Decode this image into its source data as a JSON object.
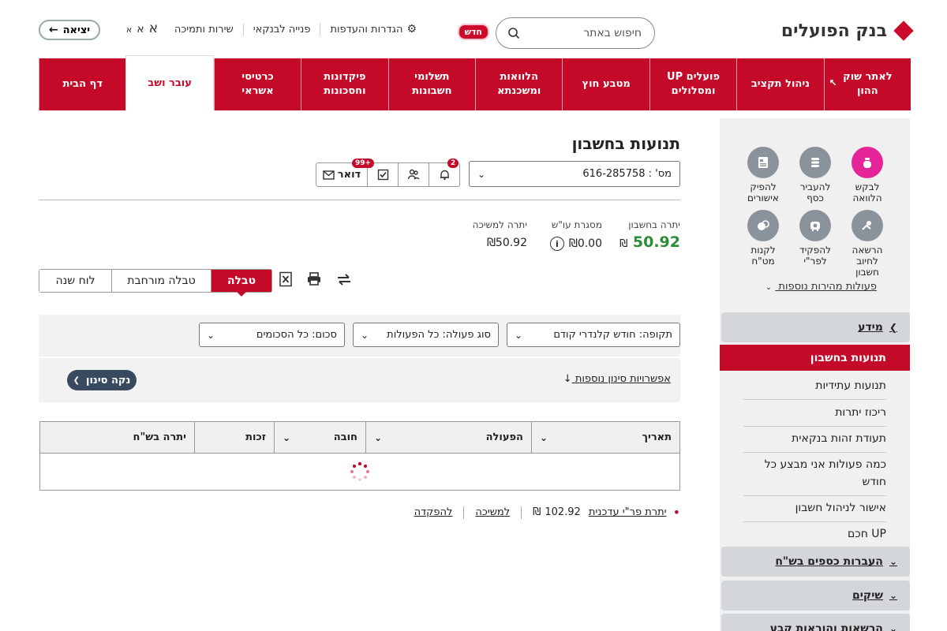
{
  "header": {
    "logo_text": "בנק הפועלים",
    "search_placeholder": "חיפוש באתר",
    "new_badge": "חדש",
    "links": [
      "הגדרות והעדפות",
      "פנייה לבנקאי",
      "שירות ותמיכה"
    ],
    "font_sizes": [
      "א",
      "א",
      "א"
    ],
    "logout_label": "יציאה"
  },
  "nav": {
    "items": [
      "דף הבית",
      "עובר ושב",
      "כרטיסי אשראי",
      "פיקדונות וחסכונות",
      "תשלומי חשבונות",
      "הלוואות ומשכנתא",
      "מטבע חוץ",
      "פועלים UP ומסלולים",
      "ניהול תקציב",
      "לאתר שוק ההון"
    ],
    "active": "עובר ושב"
  },
  "sidebar": {
    "quick_actions": [
      "לבקש הלוואה",
      "להעביר כסף",
      "להפיק אישורים",
      "הרשאה לחיוב חשבון",
      "להפקיד לפר\"י",
      "לקנות מט\"ח"
    ],
    "more_label": "פעולות מהירות נוספות",
    "sections": [
      "מידע",
      "העברות כספים בש\"ח",
      "שיקים",
      "הרשאות והוראות קבע"
    ],
    "active_item": "תנועות בחשבון",
    "sub_items": [
      "תנועות עתידיות",
      "ריכוז יתרות",
      "תעודת זהות בנקאית",
      "כמה פעולות אני מבצע כל חודש",
      "אישור לניהול חשבון",
      "UP חכם"
    ]
  },
  "main": {
    "title": "תנועות בחשבון",
    "account_label": "מס'  :  616-285758",
    "mail_label": "דואר",
    "mail_badge": "+99",
    "bell_badge": "2",
    "balances": {
      "account_label": "יתרה בחשבון",
      "account_value": "50.92",
      "currency": "₪",
      "overdraft_label": "מסגרת עו\"ש",
      "overdraft_value": "₪0.00",
      "info_glyph": "i",
      "withdraw_label": "יתרה למשיכה",
      "withdraw_value": "₪50.92"
    },
    "view_tabs": [
      "טבלה",
      "טבלה מורחבת",
      "לוח שנה"
    ],
    "filters": {
      "period": "תקופה: חודש קלנדרי קודם",
      "type": "סוג פעולה: כל הפעולות",
      "amount": "סכום: כל הסכומים"
    },
    "more_filters": "אפשרויות סינון נוספות",
    "clear_filter": "נקה סינון",
    "table_headers": [
      "תאריך",
      "הפעולה",
      "חובה",
      "זכות",
      "יתרה בש\"ח"
    ],
    "footer": {
      "updated_label": "יתרת פר\"י עדכנית",
      "updated_value": "102.92",
      "currency": "₪",
      "withdraw": "למשיכה",
      "deposit": "להפקדה"
    }
  },
  "colors": {
    "brand": "#c40a28",
    "positive": "#2c8c3a",
    "quick_pink": "#e6249a"
  }
}
